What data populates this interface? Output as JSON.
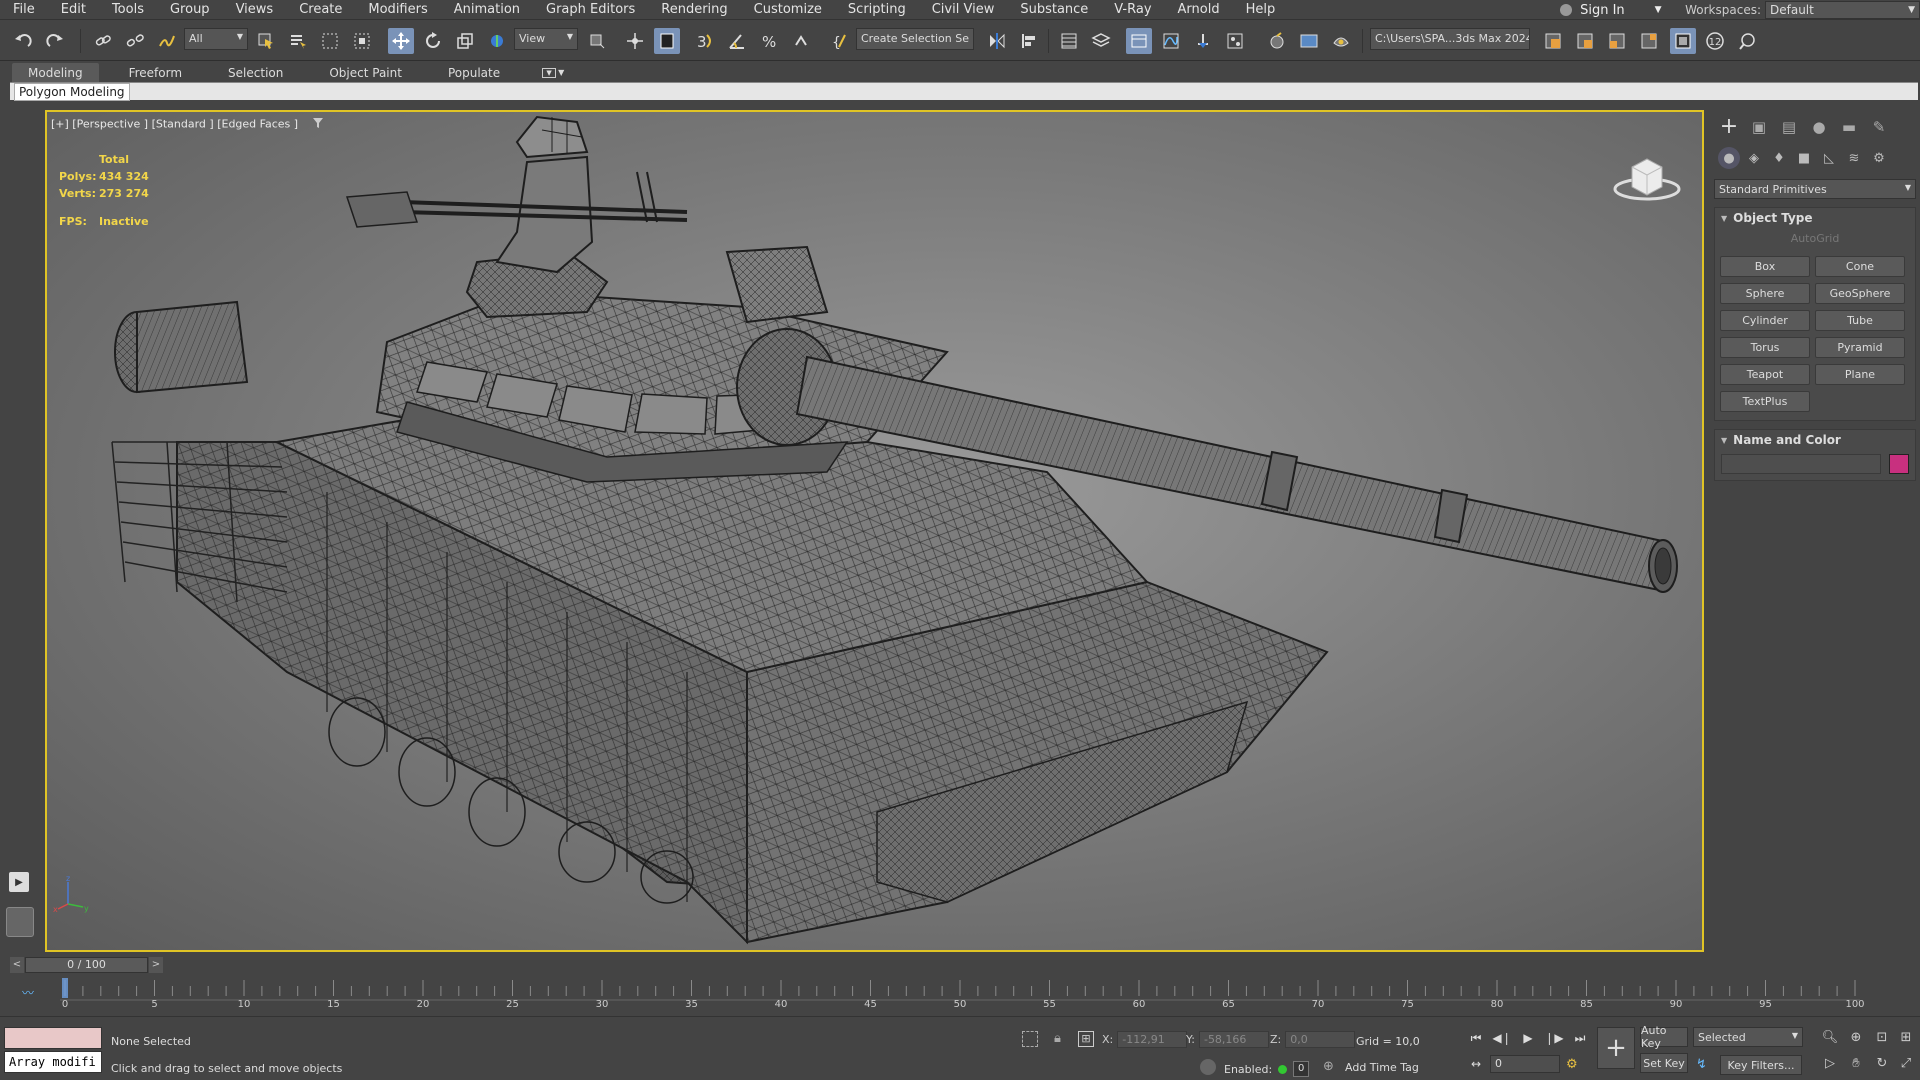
{
  "menu": [
    "File",
    "Edit",
    "Tools",
    "Group",
    "Views",
    "Create",
    "Modifiers",
    "Animation",
    "Graph Editors",
    "Rendering",
    "Customize",
    "Scripting",
    "Civil View",
    "Substance",
    "V-Ray",
    "Arnold",
    "Help"
  ],
  "signin": "Sign In",
  "workspaces_label": "Workspaces:",
  "workspace": "Default",
  "toolbar": {
    "filter": "All",
    "ref_coord": "View",
    "selection_set": "Create Selection Se",
    "project_path": "C:\\Users\\SPA...3ds Max 2024",
    "badge": "12"
  },
  "ribbon_tabs": [
    "Modeling",
    "Freeform",
    "Selection",
    "Object Paint",
    "Populate"
  ],
  "ribbon_panel": "Polygon Modeling",
  "viewport": {
    "label": "[+] [Perspective ] [Standard ] [Edged Faces ]",
    "stats_title": "Total",
    "polys_label": "Polys:",
    "polys": "434 324",
    "verts_label": "Verts:",
    "verts": "273 274",
    "fps_label": "FPS:",
    "fps": "Inactive"
  },
  "command_panel": {
    "category": "Standard Primitives",
    "object_type_title": "Object Type",
    "autogrid": "AutoGrid",
    "buttons": [
      "Box",
      "Cone",
      "Sphere",
      "GeoSphere",
      "Cylinder",
      "Tube",
      "Torus",
      "Pyramid",
      "Teapot",
      "Plane",
      "TextPlus"
    ],
    "name_color_title": "Name and Color",
    "object_color": "#c8307f"
  },
  "timeline": {
    "current": "0 / 100",
    "ticks": [
      "0",
      "5",
      "10",
      "15",
      "20",
      "25",
      "30",
      "35",
      "40",
      "45",
      "50",
      "55",
      "60",
      "65",
      "70",
      "75",
      "80",
      "85",
      "90",
      "95",
      "100"
    ]
  },
  "status": {
    "script_text": "Array modifi",
    "selection": "None Selected",
    "prompt": "Click and drag to select and move objects",
    "x_label": "X:",
    "x": "-112,91",
    "y_label": "Y:",
    "y": "-58,166",
    "z_label": "Z:",
    "z": "0,0",
    "grid": "Grid = 10,0",
    "enabled": "Enabled:",
    "enabled_value": "0",
    "add_time_tag": "Add Time Tag",
    "auto_key": "Auto Key",
    "set_key": "Set Key",
    "key_mode": "Selected",
    "frame": "0",
    "key_filters": "Key Filters..."
  }
}
